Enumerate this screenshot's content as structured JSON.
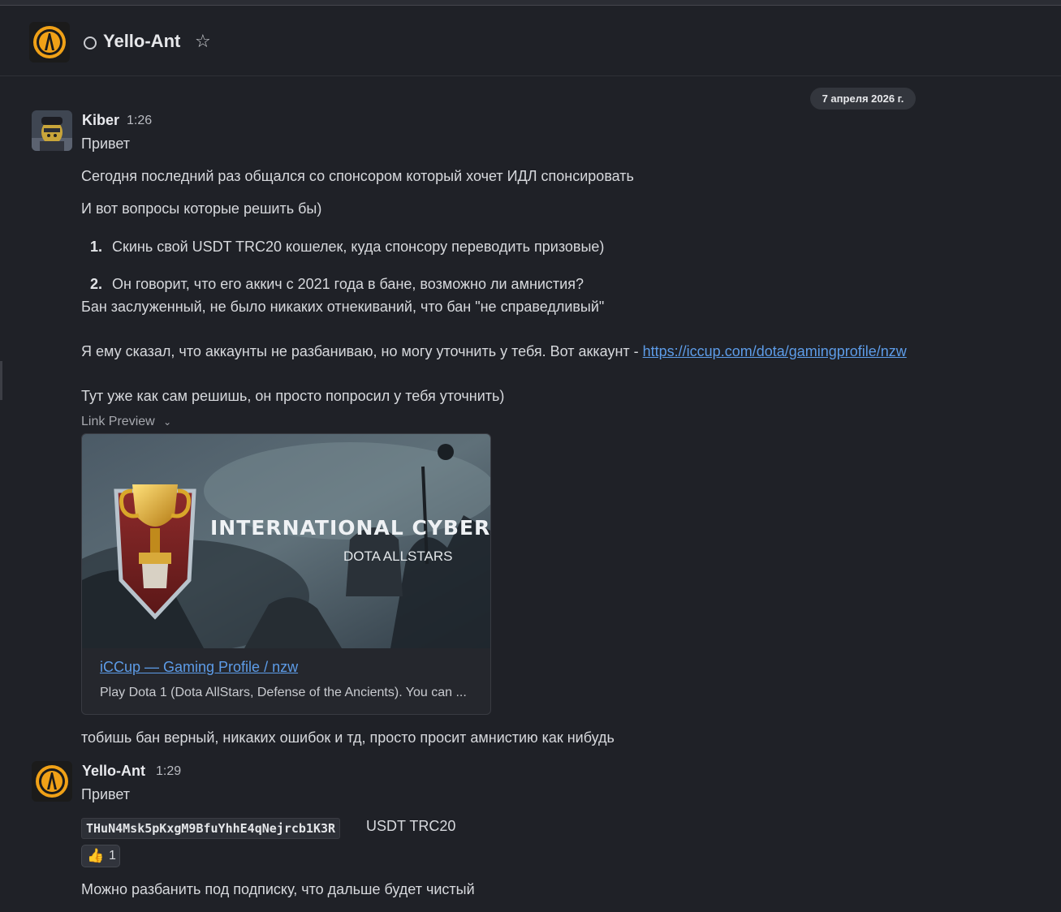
{
  "header": {
    "title": "Yello-Ant",
    "status": "offline"
  },
  "date_separator": "7 апреля 2026 г.",
  "messages": [
    {
      "author": "Kiber",
      "time": "1:26",
      "lines": [
        "Привет",
        "Сегодня последний раз общался со спонсором который хочет ИДЛ спонсировать",
        "И вот вопросы которые решить бы)"
      ],
      "list": [
        {
          "num": "1.",
          "text": "Скинь свой USDT TRC20 кошелек, куда спонсору переводить призовые)"
        },
        {
          "num": "2.",
          "text": "Он говорит, что его аккич с 2021 года в бане, возможно ли амнистия?"
        }
      ],
      "after_list": "Бан заслуженный, не было никаких отнекиваний, что бан \"не справедливый\"",
      "account_text": "Я ему сказал, что аккаунты не разбаниваю, но могу уточнить у тебя. Вот аккаунт - ",
      "account_link": "https://iccup.com/dota/gamingprofile/nzw",
      "closing": "Тут уже как сам решишь, он просто попросил у тебя уточнить)",
      "link_preview": {
        "label": "Link Preview",
        "image_title": "INTERNATIONAL CYBER CUP",
        "image_subtitle": "DOTA ALLSTARS",
        "title": "iCCup — Gaming Profile / nzw",
        "description": "Play Dota 1 (Dota AllStars, Defense of the Ancients). You can ..."
      },
      "followup": "тобишь бан верный, никаких ошибок и тд, просто просит амнистию как нибудь"
    },
    {
      "author": "Yello-Ant",
      "time": "1:29",
      "lines": [
        "Привет"
      ],
      "code": "THuN4Msk5pKxgM9BfuYhhE4qNejrcb1K3R",
      "code_suffix": "USDT TRC20",
      "reaction": {
        "emoji": "👍",
        "count": "1"
      },
      "last": "Можно разбанить под подписку, что дальше будет чистый"
    }
  ],
  "colors": {
    "background": "#1f2127",
    "link": "#5d9ce8",
    "logo_orange": "#f0a117"
  }
}
